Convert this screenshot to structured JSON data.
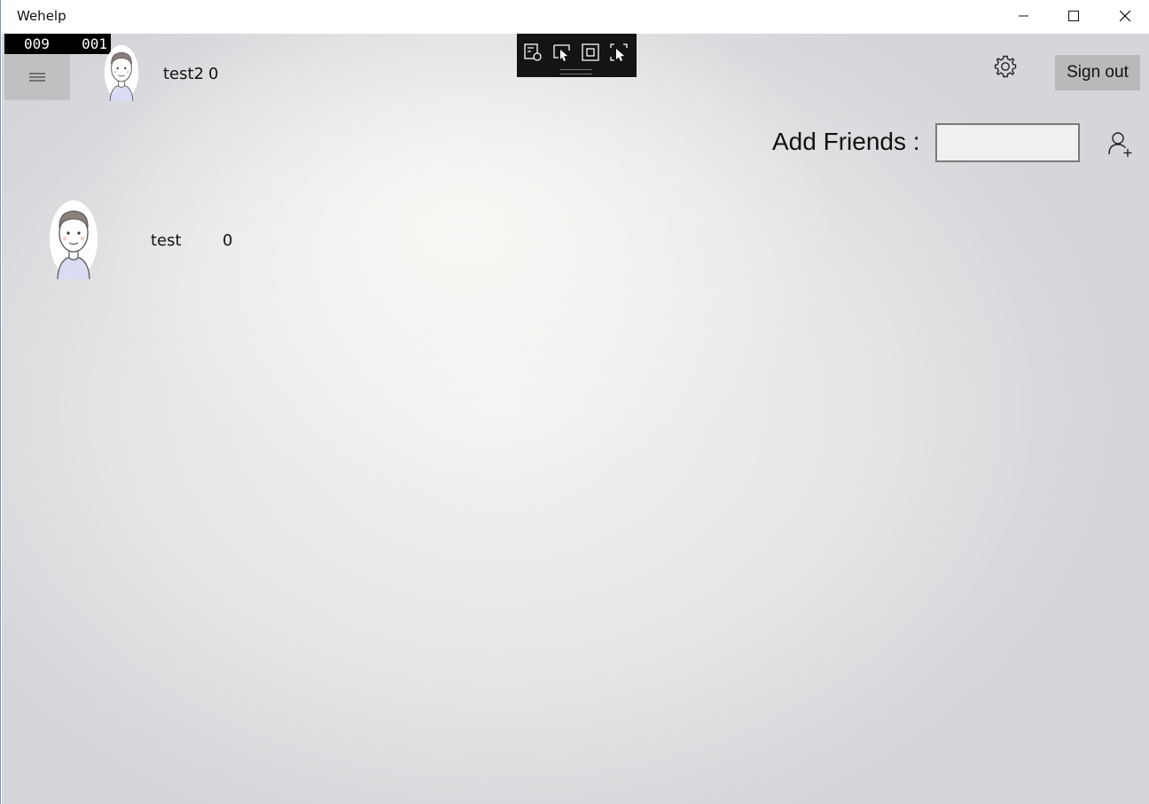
{
  "window": {
    "title": "Wehelp",
    "minimize_icon": "minimize-icon",
    "maximize_icon": "maximize-icon",
    "close_icon": "close-icon"
  },
  "counter": {
    "left": "009",
    "right": "001"
  },
  "header": {
    "menu_icon": "hamburger-icon",
    "current_user": {
      "name": "test2",
      "count": "0"
    },
    "settings_icon": "gear-icon",
    "signout_label": "Sign out"
  },
  "dev_toolbar": {
    "tools": [
      "live-visual-tree-icon",
      "select-element-icon",
      "display-layout-adorners-icon",
      "track-focused-element-icon"
    ]
  },
  "add_friends": {
    "label": "Add Friends :",
    "input_value": "",
    "button_icon": "add-user-icon"
  },
  "friends": [
    {
      "name": "test",
      "count": "0"
    }
  ],
  "colors": {
    "signout_bg": "#b9b9bc",
    "menu_bg": "#c0c0c2",
    "toolbar_bg": "#141414"
  }
}
